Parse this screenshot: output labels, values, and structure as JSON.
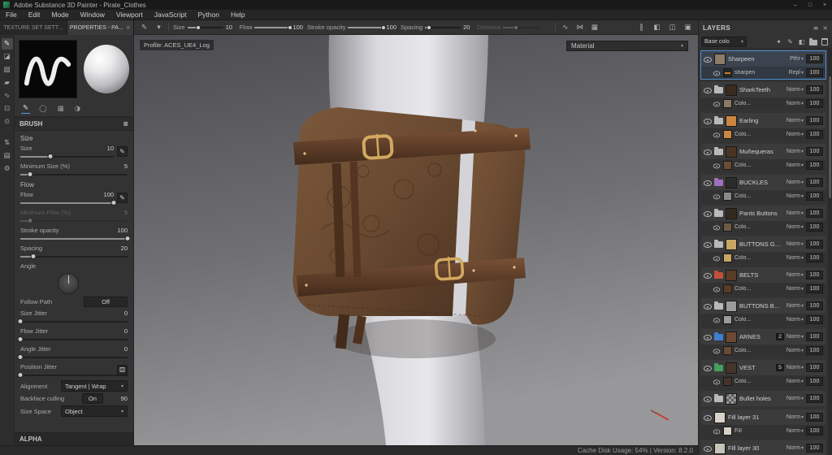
{
  "window": {
    "title": "Adobe Substance 3D Painter - Pirate_Clothes",
    "controls": {
      "minimize": "–",
      "maximize": "□",
      "close": "×"
    }
  },
  "menu": {
    "items": [
      "File",
      "Edit",
      "Mode",
      "Window",
      "Viewport",
      "JavaScript",
      "Python",
      "Help"
    ]
  },
  "panel_tabs": {
    "items": [
      {
        "label": "TEXTURE SET SETT..."
      },
      {
        "label": "PROPERTIES - PA...",
        "close": "×"
      }
    ]
  },
  "tool_strip": {
    "items": [
      {
        "name": "paint-tool-icon",
        "glyph": "✎",
        "active": true
      },
      {
        "name": "eraser-tool-icon",
        "glyph": "◪"
      },
      {
        "name": "projection-tool-icon",
        "glyph": "▧"
      },
      {
        "name": "polygon-fill-tool-icon",
        "glyph": "▰"
      },
      {
        "name": "smudge-tool-icon",
        "glyph": "∿"
      },
      {
        "name": "clone-tool-icon",
        "glyph": "⊡"
      },
      {
        "name": "material-picker-icon",
        "glyph": "⊙"
      },
      {
        "name": "export-icon",
        "glyph": "⇅"
      },
      {
        "name": "display-settings-icon",
        "glyph": "▤"
      },
      {
        "name": "settings-icon",
        "glyph": "⚙"
      }
    ]
  },
  "toolbar": {
    "left_icons": [
      {
        "name": "brush-preset-icon",
        "glyph": "✎"
      },
      {
        "name": "stroke-preset-caret-icon",
        "glyph": "▾"
      }
    ],
    "params": [
      {
        "label": "Size",
        "value": "10",
        "fill": 30
      },
      {
        "label": "Flow",
        "value": "100",
        "fill": 100
      },
      {
        "label": "Stroke opacity",
        "value": "100",
        "fill": 100
      },
      {
        "label": "Spacing",
        "value": "20",
        "fill": 10
      },
      {
        "label": "Distance",
        "value": "",
        "fill": 35,
        "disabled": true
      }
    ],
    "mid_icons": [
      {
        "name": "lazy-mouse-icon",
        "glyph": "∿"
      },
      {
        "name": "symmetry-icon",
        "glyph": "⋈"
      },
      {
        "name": "grid-snap-icon",
        "glyph": "▦"
      }
    ],
    "right_icons": [
      {
        "name": "pause-engine-icon",
        "glyph": "‖"
      },
      {
        "name": "viewport-solo-icon",
        "glyph": "◧"
      },
      {
        "name": "viewport-split-icon",
        "glyph": "◫"
      },
      {
        "name": "camera-settings-icon",
        "glyph": "▣"
      }
    ]
  },
  "properties": {
    "brush_header": "BRUSH",
    "params": [
      {
        "type": "section",
        "label": "Size"
      },
      {
        "type": "slider",
        "label": "Size",
        "value": "10",
        "fill": 32,
        "icon": true
      },
      {
        "type": "slider",
        "label": "Minimum Size (%)",
        "value": "5",
        "fill": 9
      },
      {
        "type": "section",
        "label": "Flow"
      },
      {
        "type": "slider",
        "label": "Flow",
        "value": "100",
        "fill": 100,
        "icon": true
      },
      {
        "type": "slider",
        "label": "Minimum Flow (%)",
        "value": "5",
        "fill": 9,
        "disabled": true
      },
      {
        "type": "slider",
        "label": "Stroke opacity",
        "value": "100",
        "fill": 100
      },
      {
        "type": "slider",
        "label": "Spacing",
        "value": "20",
        "fill": 12
      },
      {
        "type": "dial",
        "label": "Angle"
      },
      {
        "type": "button",
        "label": "Follow Path",
        "value": "Off"
      },
      {
        "type": "slider",
        "label": "Size Jitter",
        "value": "0",
        "fill": 0
      },
      {
        "type": "slider",
        "label": "Flow Jitter",
        "value": "0",
        "fill": 0
      },
      {
        "type": "slider",
        "label": "Angle Jitter",
        "value": "0",
        "fill": 0
      },
      {
        "type": "slider",
        "label": "Position Jitter",
        "value": "0",
        "fill": 0,
        "icon2": true
      },
      {
        "type": "select",
        "label": "Alignment",
        "value": "Tangent | Wrap"
      },
      {
        "type": "toggle",
        "label": "Backface culling",
        "value": "On",
        "extra": "90"
      },
      {
        "type": "select",
        "label": "Size Space",
        "value": "Object"
      }
    ],
    "alpha_header": "ALPHA"
  },
  "viewport": {
    "profile_label": "Profile: ACES_UE4_Log",
    "shader_dropdown": "Material"
  },
  "layers_panel": {
    "title": "LAYERS",
    "header_icons": [
      {
        "name": "panel-menu-icon",
        "glyph": "≡"
      },
      {
        "name": "close-panel-icon",
        "glyph": "×"
      }
    ],
    "blend_dropdown": "Base colo",
    "tool_icons": [
      {
        "name": "add-mask-icon",
        "glyph": "✦"
      },
      {
        "name": "add-paint-layer-icon",
        "glyph": "✎"
      },
      {
        "name": "add-fill-layer-icon",
        "glyph": "◧"
      },
      {
        "name": "add-folder-icon",
        "glyph": "",
        "css": "folder"
      },
      {
        "name": "delete-layer-icon",
        "glyph": "",
        "css": "trash"
      }
    ],
    "items": [
      {
        "name": "Sharpeen",
        "mode": "Pthr",
        "opacity": "100",
        "selected": true,
        "thumb": "#8d7a68",
        "sub": {
          "name": "sharpen",
          "mode": "Repl",
          "opacity": "100",
          "thumb": "fx"
        }
      },
      {
        "name": "SharkTeeth",
        "folder": true,
        "folder_color": "#b9b9b9",
        "thumb": "#3a2b1e",
        "mode": "Norm",
        "opacity": "100",
        "sub": {
          "name": "Colo...",
          "mode": "Norm",
          "opacity": "100",
          "thumb": "#8a7a66"
        }
      },
      {
        "name": "Earling",
        "folder": true,
        "folder_color": "#b9b9b9",
        "thumb": "#c9873f",
        "mode": "Norm",
        "opacity": "100",
        "sub": {
          "name": "Colo...",
          "mode": "Norm",
          "opacity": "100",
          "thumb": "#c9873f"
        }
      },
      {
        "name": "Muñequeras",
        "folder": true,
        "folder_color": "#b9b9b9",
        "thumb": "#4a3423",
        "mode": "Norm",
        "opacity": "100",
        "sub": {
          "name": "Colo...",
          "mode": "Norm",
          "opacity": "100",
          "thumb": "#6b4e35"
        }
      },
      {
        "name": "BUCKLES",
        "folder": true,
        "folder_color": "#9f6fc0",
        "thumb": "#2c2c2c",
        "mode": "Norm",
        "opacity": "100",
        "sub": {
          "name": "Colo...",
          "mode": "Norm",
          "opacity": "100",
          "thumb": "#8a8a8a"
        }
      },
      {
        "name": "Pants Buttons",
        "folder": true,
        "folder_color": "#b9b9b9",
        "thumb": "#33291f",
        "mode": "Norm",
        "opacity": "100",
        "sub": {
          "name": "Colo...",
          "mode": "Norm",
          "opacity": "100",
          "thumb": "#6e5a44"
        }
      },
      {
        "name": "BUTTONS GOLD",
        "folder": true,
        "folder_color": "#b9b9b9",
        "thumb": "#c8a563",
        "mode": "Norm",
        "opacity": "100",
        "sub": {
          "name": "Colo...",
          "mode": "Norm",
          "opacity": "100",
          "thumb": "#c8a563"
        }
      },
      {
        "name": "BELTS",
        "folder": true,
        "folder_color": "#c25039",
        "thumb": "#5a3b26",
        "mode": "Norm",
        "opacity": "100",
        "sub": {
          "name": "Colo...",
          "mode": "Norm",
          "opacity": "100",
          "thumb": "#5a3b26"
        }
      },
      {
        "name": "BUTTONS BOLT",
        "folder": true,
        "folder_color": "#b9b9b9",
        "thumb": "#9b9b9b",
        "mode": "Norm",
        "opacity": "100",
        "sub": {
          "name": "Colo...",
          "mode": "Norm",
          "opacity": "100",
          "thumb": "#9b9b9b"
        }
      },
      {
        "name": "ARNES",
        "folder": true,
        "folder_color": "#3f7fd2",
        "thumb": "#6b4a33",
        "mode": "Norm",
        "opacity": "100",
        "badge": "2",
        "sub": {
          "name": "Colo...",
          "mode": "Norm",
          "opacity": "100",
          "thumb": "#6b4a33"
        }
      },
      {
        "name": "VEST",
        "folder": true,
        "folder_color": "#43a05f",
        "thumb": "#46342a",
        "mode": "Norm",
        "opacity": "100",
        "badge": "5",
        "sub": {
          "name": "Colo...",
          "mode": "Norm",
          "opacity": "100",
          "thumb": "#46342a"
        }
      },
      {
        "name": "Bullet holes",
        "folder": true,
        "folder_color": "#b9b9b9",
        "thumb": "checker",
        "mode": "Norm",
        "opacity": "100"
      },
      {
        "name": "Fill layer 31",
        "thumb": "#d8d2c8",
        "mode": "Norm",
        "opacity": "100",
        "sub": {
          "name": "Fill",
          "mode": "Norm",
          "opacity": "100",
          "thumb": "#d8d2c8"
        }
      },
      {
        "name": "Fill layer 30",
        "thumb": "#c8c2b8",
        "mode": "Norm",
        "opacity": "100"
      }
    ]
  },
  "statusbar": {
    "text": "Cache Disk Usage: 54% | Version: 8.2.0"
  },
  "colors": {
    "selection_blue": "#4f8fd0",
    "panel_bg": "#333333",
    "viewport_top": "#4c4c50",
    "viewport_bottom": "#97979a",
    "leather_brown": "#6a4a31",
    "buckle_gold": "#d2a960"
  }
}
